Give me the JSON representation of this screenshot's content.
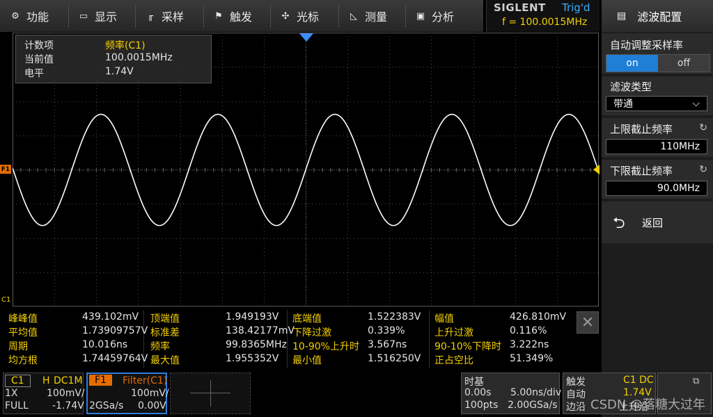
{
  "menu": {
    "items": [
      {
        "label": "功能",
        "icon": "settings-icon",
        "glyph": "⚙"
      },
      {
        "label": "显示",
        "icon": "display-icon",
        "glyph": "▭"
      },
      {
        "label": "采样",
        "icon": "sample-icon",
        "glyph": "╓"
      },
      {
        "label": "触发",
        "icon": "trigger-flag-icon",
        "glyph": "⚑"
      },
      {
        "label": "光标",
        "icon": "cursor-icon",
        "glyph": "✣"
      },
      {
        "label": "测量",
        "icon": "measure-icon",
        "glyph": "◺"
      },
      {
        "label": "分析",
        "icon": "analysis-icon",
        "glyph": "▣"
      }
    ]
  },
  "brand": {
    "name": "SIGLENT",
    "trig_status": "Trig'd",
    "freq": "f = 100.0015MHz"
  },
  "right_panel": {
    "title": "滤波配置",
    "title_icon": "filter-menu-icon",
    "auto_rate_label": "自动调整采样率",
    "toggle_on": "on",
    "toggle_off": "off",
    "filter_type_label": "滤波类型",
    "filter_type_value": "带通",
    "upper_cutoff_label": "上限截止频率",
    "upper_cutoff_value": "110MHz",
    "lower_cutoff_label": "下限截止频率",
    "lower_cutoff_value": "90.0MHz",
    "back_label": "返回"
  },
  "meas_box": {
    "rows": [
      {
        "key": "计数项",
        "value": "频率(C1)",
        "value_color": "#f4d000"
      },
      {
        "key": "当前值",
        "value": "100.0015MHz",
        "value_color": "#e6e6e6"
      },
      {
        "key": "电平",
        "value": "1.74V",
        "value_color": "#e6e6e6"
      }
    ]
  },
  "markers": {
    "f1": "F1",
    "c1": "C1"
  },
  "measurements": [
    [
      {
        "k": "峰峰值",
        "v": "439.102mV"
      },
      {
        "k": "顶端值",
        "v": "1.949193V"
      },
      {
        "k": "底端值",
        "v": "1.522383V"
      },
      {
        "k": "幅值",
        "v": "426.810mV"
      }
    ],
    [
      {
        "k": "平均值",
        "v": "1.73909757V"
      },
      {
        "k": "标准差",
        "v": "138.42177mV"
      },
      {
        "k": "下降过激",
        "v": "0.339%"
      },
      {
        "k": "上升过激",
        "v": "0.116%"
      }
    ],
    [
      {
        "k": "周期",
        "v": "10.016ns"
      },
      {
        "k": "频率",
        "v": "99.8365MHz"
      },
      {
        "k": "10-90%上升时",
        "v": "3.567ns"
      },
      {
        "k": "90-10%下降时",
        "v": "3.222ns"
      }
    ],
    [
      {
        "k": "均方根",
        "v": "1.74459764V"
      },
      {
        "k": "最大值",
        "v": "1.955352V"
      },
      {
        "k": "最小值",
        "v": "1.516250V"
      },
      {
        "k": "正占空比",
        "v": "51.349%"
      }
    ]
  ],
  "channels": {
    "c1": {
      "name": "C1",
      "coupling_prefix": "H",
      "coupling": "DC1M",
      "probe": "1X",
      "scale": "100mV/",
      "bw": "FULL",
      "offset": "-1.74V"
    },
    "f1": {
      "name": "F1",
      "source": "Filter(C1)",
      "scale": "100mV/",
      "rate": "2GSa/s",
      "offset": "0.00V"
    }
  },
  "timebase": {
    "label": "时基",
    "delay": "0.00s",
    "scale": "5.00ns/div",
    "points": "100pts",
    "rate": "2.00GSa/s"
  },
  "trigger": {
    "label": "触发",
    "source": "C1 DC",
    "mode": "自动",
    "level": "1.74V",
    "type": "边沿",
    "slope": "上升沿"
  },
  "watermark": "CSDN @落糖大过年",
  "colors": {
    "accent_yellow": "#f4d000",
    "accent_blue": "#2d7de0",
    "f1_orange": "#e46d00",
    "trace": "#ffffff"
  }
}
